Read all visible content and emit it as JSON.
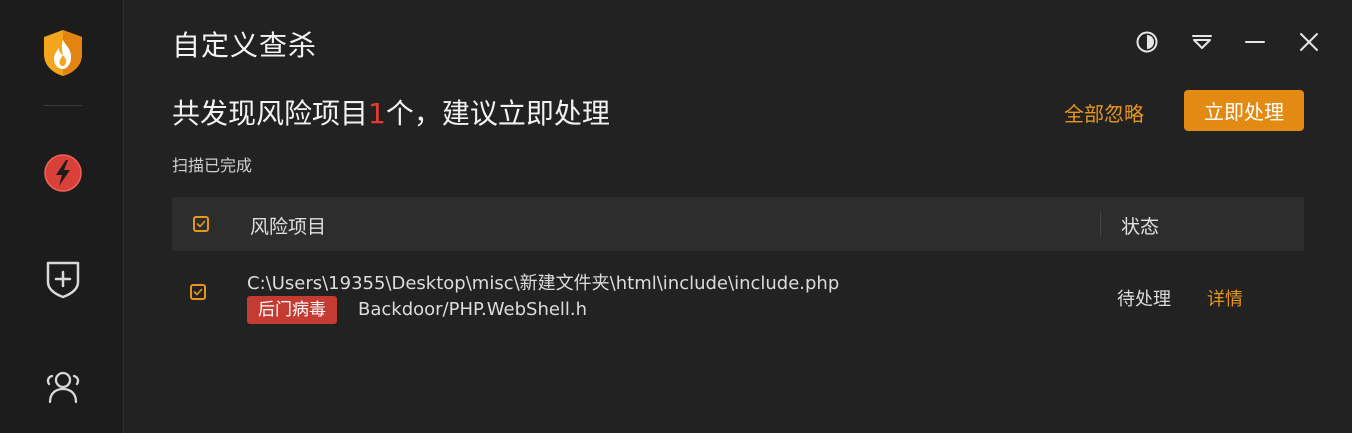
{
  "window": {
    "title": "自定义查杀",
    "controls": [
      "theme-icon",
      "menu-icon",
      "minimize-icon",
      "close-icon"
    ]
  },
  "sidebar": {
    "logo": "shield-flame-logo",
    "items": [
      {
        "icon": "lightning-scan-icon"
      },
      {
        "icon": "shield-plus-icon"
      },
      {
        "icon": "users-icon"
      }
    ]
  },
  "summary": {
    "prefix": "共发现风险项目",
    "count": "1",
    "suffix": "个，建议立即处理",
    "scan_status": "扫描已完成"
  },
  "actions": {
    "ignore_all": "全部忽略",
    "handle_now": "立即处理"
  },
  "table": {
    "headers": {
      "risk": "风险项目",
      "state": "状态"
    },
    "header_checked": true,
    "rows": [
      {
        "checked": true,
        "path": "C:\\Users\\19355\\Desktop\\misc\\新建文件夹\\html\\include\\include.php",
        "tag": "后门病毒",
        "virus": "Backdoor/PHP.WebShell.h",
        "state": "待处理",
        "detail": "详情"
      }
    ]
  },
  "colors": {
    "accent": "#e8951d",
    "danger": "#c43b32",
    "count": "#e63b2e",
    "background": "#222222",
    "sidebar": "#1c1c1c"
  }
}
